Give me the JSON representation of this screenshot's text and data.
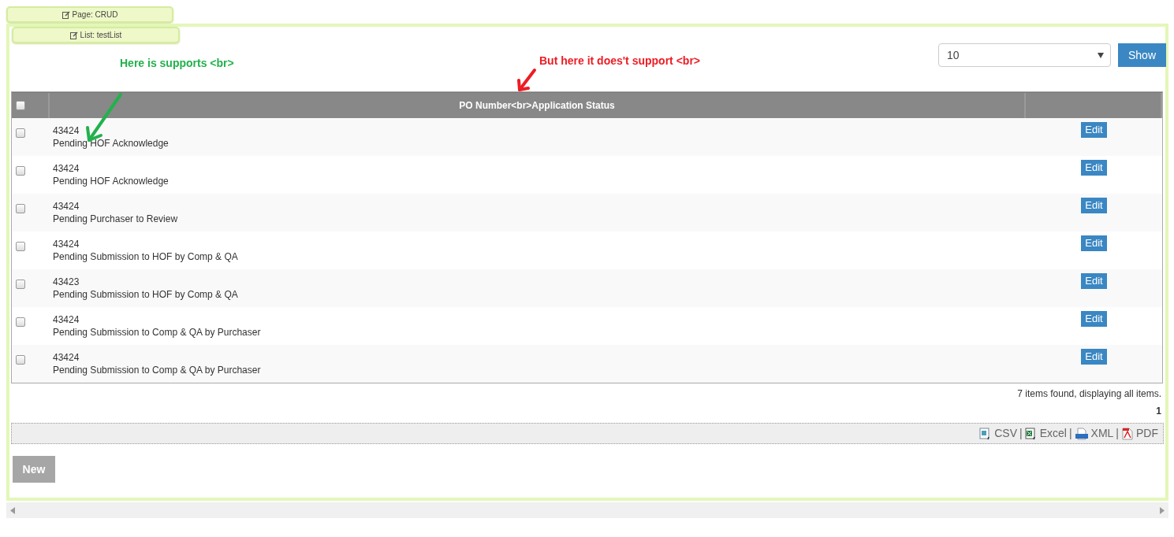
{
  "page_tag": "Page: CRUD",
  "list_tag": "List: testList",
  "annotations": [
    {
      "text": "Here is supports <br>",
      "color": "#22b14c"
    },
    {
      "text": "But here it does't support <br>",
      "color": "#ed1c24"
    }
  ],
  "page_size": {
    "value": "10"
  },
  "show_button": "Show",
  "table": {
    "header_checked": false,
    "columns": [
      "PO Number<br>Application Status"
    ],
    "rows": [
      {
        "checked": false,
        "po": "43424",
        "status": "Pending HOF Acknowledge",
        "action": "Edit"
      },
      {
        "checked": false,
        "po": "43424",
        "status": "Pending HOF Acknowledge",
        "action": "Edit"
      },
      {
        "checked": false,
        "po": "43424",
        "status": "Pending Purchaser to Review",
        "action": "Edit"
      },
      {
        "checked": false,
        "po": "43424",
        "status": "Pending Submission to HOF by Comp & QA",
        "action": "Edit"
      },
      {
        "checked": false,
        "po": "43423",
        "status": "Pending Submission to HOF by Comp & QA",
        "action": "Edit"
      },
      {
        "checked": false,
        "po": "43424",
        "status": "Pending Submission to Comp & QA by Purchaser",
        "action": "Edit"
      },
      {
        "checked": false,
        "po": "43424",
        "status": "Pending Submission to Comp & QA by Purchaser",
        "action": "Edit"
      }
    ]
  },
  "summary": "7 items found, displaying all items.",
  "pager": "1",
  "export_separator": "|",
  "exports": [
    {
      "kind": "csv",
      "label": "CSV"
    },
    {
      "kind": "excel",
      "label": "Excel"
    },
    {
      "kind": "xml",
      "label": "XML"
    },
    {
      "kind": "pdf",
      "label": "PDF"
    }
  ],
  "new_button": "New"
}
